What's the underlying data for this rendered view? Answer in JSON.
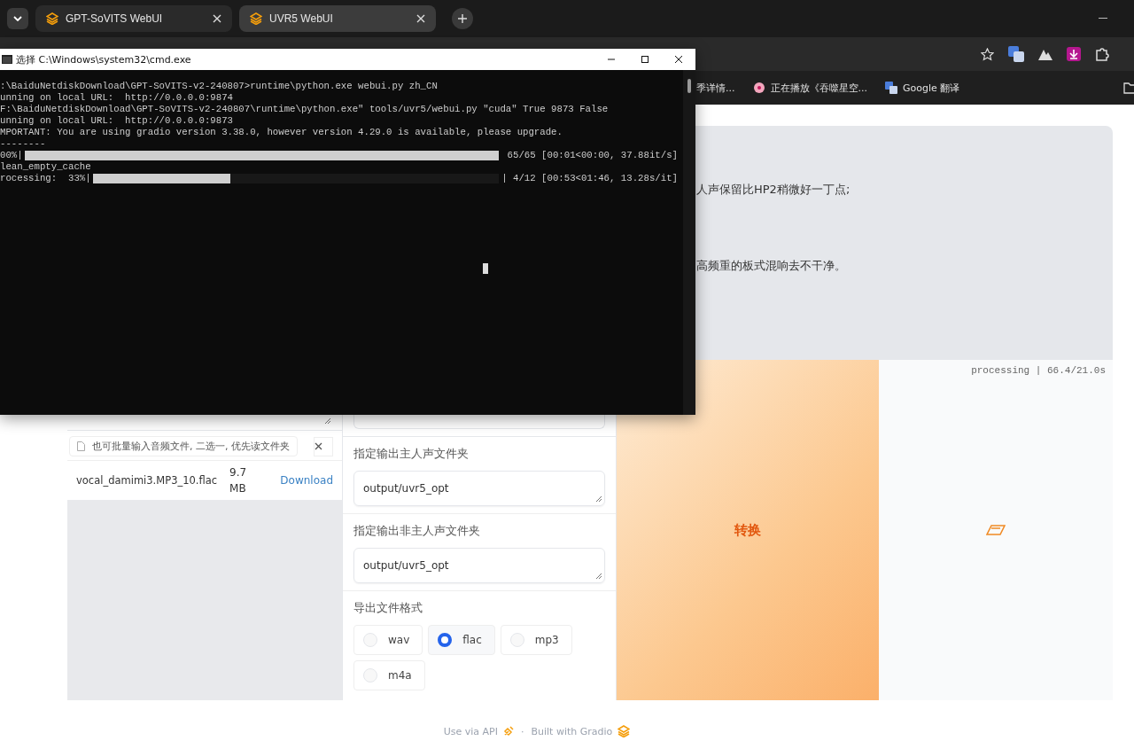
{
  "browser": {
    "tabs": [
      {
        "title": "GPT-SoVITS WebUI",
        "selected": false
      },
      {
        "title": "UVR5 WebUI",
        "selected": true
      }
    ],
    "bookmarks": [
      {
        "label": "季详情..."
      },
      {
        "label": "正在播放《吞噬星空..."
      },
      {
        "label": "Google 翻译"
      }
    ]
  },
  "console_window": {
    "title": "选择 C:\\Windows\\system32\\cmd.exe",
    "lines": [
      {
        "kind": "text",
        "text": ":\\BaiduNetdiskDownload\\GPT-SoVITS-v2-240807>runtime\\python.exe webui.py zh_CN"
      },
      {
        "kind": "text",
        "text": "unning on local URL:  http://0.0.0.0:9874"
      },
      {
        "kind": "text",
        "text": "F:\\BaiduNetdiskDownload\\GPT-SoVITS-v2-240807\\runtime\\python.exe\" tools/uvr5/webui.py \"cuda\" True 9873 False"
      },
      {
        "kind": "text",
        "text": "unning on local URL:  http://0.0.0.0:9873"
      },
      {
        "kind": "text",
        "text": "MPORTANT: You are using gradio version 3.38.0, however version 4.29.0 is available, please upgrade."
      },
      {
        "kind": "text",
        "text": "--------"
      },
      {
        "kind": "progress",
        "prefix": "00%|",
        "level": 1,
        "suffix": "65/65 [00:01<00:00, 37.88it/s]"
      },
      {
        "kind": "text",
        "text": "lean_empty_cache"
      },
      {
        "kind": "progress",
        "prefix": "rocessing:  33%|",
        "level": 0.34,
        "suffix": "| 4/12 [00:53<01:46, 13.28s/it]"
      }
    ]
  },
  "description": {
    "lines": [
      "人声保留比HP2稍微好一丁点;",
      "高频重的板式混响去不干净。"
    ]
  },
  "input_panel": {
    "file_hint": "也可批量输入音频文件, 二选一, 优先读文件夹",
    "files": [
      {
        "name": "vocal_damimi3.MP3_10.flac",
        "size": "9.7 MB",
        "action": "Download"
      }
    ]
  },
  "settings": {
    "fields": [
      {
        "label": "指定输出主人声文件夹",
        "value": "output/uvr5_opt"
      },
      {
        "label": "指定输出非主人声文件夹",
        "value": "output/uvr5_opt"
      }
    ],
    "format": {
      "label": "导出文件格式",
      "options": [
        {
          "label": "wav",
          "selected": false
        },
        {
          "label": "flac",
          "selected": true
        },
        {
          "label": "mp3",
          "selected": false
        },
        {
          "label": "m4a",
          "selected": false
        }
      ]
    }
  },
  "convert_button": "转换",
  "output": {
    "status": "processing | 66.4/21.0s"
  },
  "footer": {
    "api_link": "Use via API",
    "separator": "·",
    "built_with": "Built with Gradio"
  }
}
